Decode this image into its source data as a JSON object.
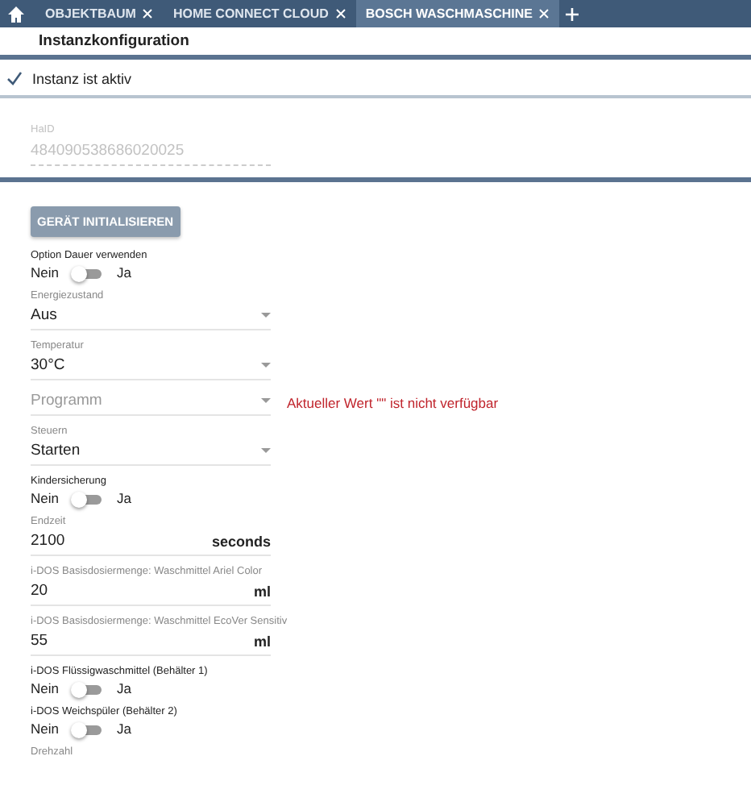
{
  "tabs": [
    {
      "label": "OBJEKTBAUM",
      "selected": false
    },
    {
      "label": "HOME CONNECT CLOUD",
      "selected": false
    },
    {
      "label": "BOSCH WASCHMASCHINE",
      "selected": true
    }
  ],
  "header": {
    "title": "Instanzkonfiguration"
  },
  "instance": {
    "label": "Instanz ist aktiv",
    "checked": true
  },
  "haid": {
    "label": "HaID",
    "value": "484090538686020025"
  },
  "init_button": "GERÄT INITIALISIEREN",
  "fields": [
    {
      "kind": "toggle",
      "label": "Option Dauer verwenden",
      "off_label": "Nein",
      "on_label": "Ja",
      "on": false
    },
    {
      "kind": "select",
      "label": "Energiezustand",
      "value": "Aus"
    },
    {
      "kind": "select",
      "label": "Temperatur",
      "value": "30°C"
    },
    {
      "kind": "select",
      "placeholder": "Programm",
      "error": "Aktueller Wert \"\" ist nicht verfügbar"
    },
    {
      "kind": "select",
      "label": "Steuern",
      "value": "Starten"
    },
    {
      "kind": "toggle",
      "label": "Kindersicherung",
      "off_label": "Nein",
      "on_label": "Ja",
      "on": false
    },
    {
      "kind": "number",
      "label": "Endzeit",
      "value": "2100",
      "unit": "seconds"
    },
    {
      "kind": "number",
      "label": "i-DOS Basisdosiermenge: Waschmittel Ariel Color",
      "value": "20",
      "unit": "ml"
    },
    {
      "kind": "number",
      "label": "i-DOS Basisdosiermenge: Waschmittel EcoVer Sensitiv",
      "value": "55",
      "unit": "ml"
    },
    {
      "kind": "toggle",
      "label": "i-DOS Flüssigwaschmittel (Behälter 1)",
      "off_label": "Nein",
      "on_label": "Ja",
      "on": false
    },
    {
      "kind": "toggle",
      "label": "i-DOS Weichspüler (Behälter 2)",
      "off_label": "Nein",
      "on_label": "Ja",
      "on": false
    },
    {
      "kind": "heading",
      "label": "Drehzahl"
    }
  ]
}
